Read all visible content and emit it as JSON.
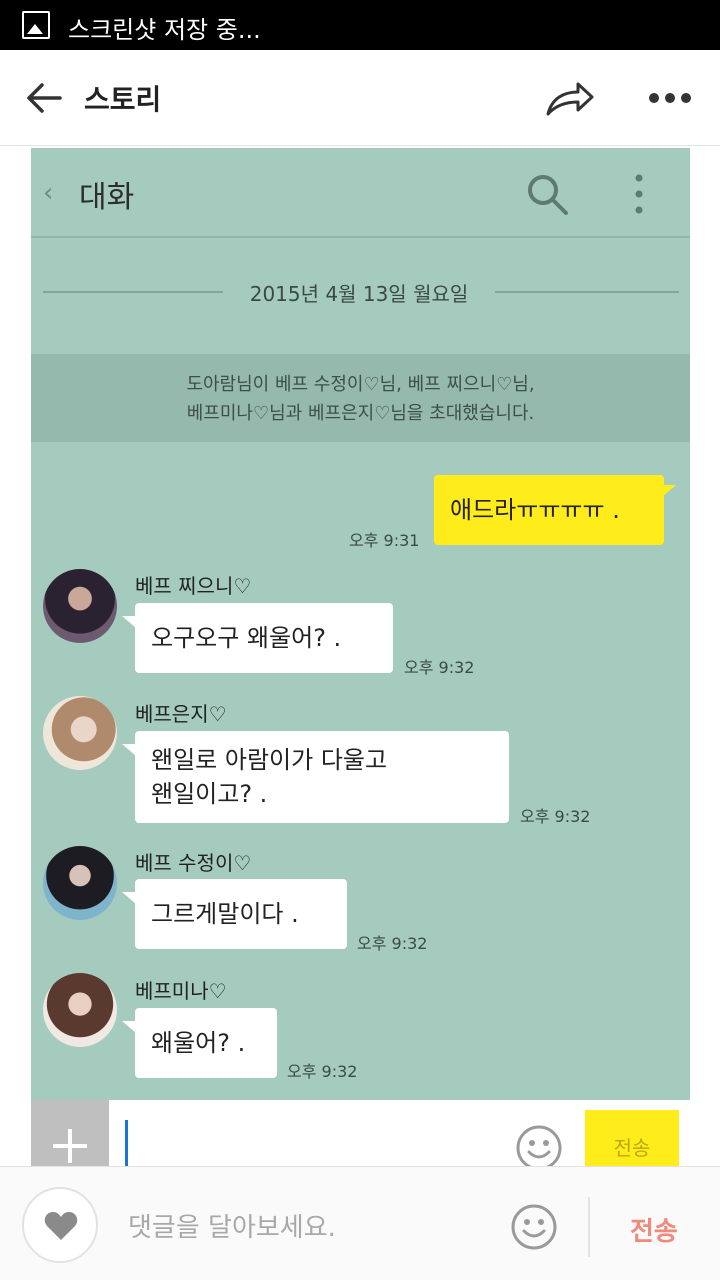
{
  "status_bar": {
    "text": "스크린샷 저장 중..."
  },
  "app_bar": {
    "title": "스토리"
  },
  "chat": {
    "header_title": "대화",
    "date": "2015년 4월 13일 월요일",
    "system_message": {
      "line1": "도아람님이 베프 수정이♡님, 베프 찌으니♡님,",
      "line2": "베프미나♡님과 베프은지♡님을 초대했습니다."
    },
    "messages": [
      {
        "sender": "",
        "text": "애드라ㅠㅠㅠㅠ .",
        "time": "오후 9:31"
      },
      {
        "sender": "베프 찌으니♡",
        "text": "오구오구 왜울어? .",
        "time": "오후 9:32"
      },
      {
        "sender": "베프은지♡",
        "text_line1": "왠일로 아람이가 다울고",
        "text_line2": "왠일이고? .",
        "time": "오후 9:32"
      },
      {
        "sender": "베프 수정이♡",
        "text": "그르게말이다 .",
        "time": "오후 9:32"
      },
      {
        "sender": "베프미나♡",
        "text": "왜울어? .",
        "time": "오후 9:32"
      }
    ],
    "send_label": "전송"
  },
  "comment_bar": {
    "placeholder": "댓글을 달아보세요.",
    "send_label": "전송"
  },
  "colors": {
    "chat_bg": "#a4cbbd",
    "my_bubble": "#ffec1a",
    "send_accent": "#f08a7b"
  }
}
